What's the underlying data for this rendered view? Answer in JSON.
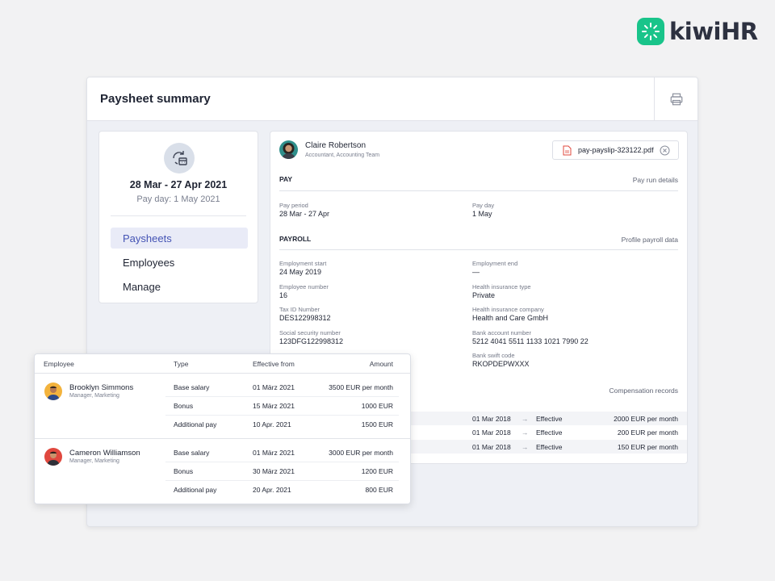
{
  "brand": {
    "name": "kiwiHR",
    "color": "#19c48a"
  },
  "window": {
    "title": "Paysheet summary",
    "print_icon": "printer-icon"
  },
  "period": {
    "icon": "calendar-cycle-icon",
    "range": "28 Mar - 27 Apr 2021",
    "payday": "Pay day: 1 May 2021"
  },
  "nav": {
    "items": [
      {
        "label": "Paysheets",
        "active": true
      },
      {
        "label": "Employees",
        "active": false
      },
      {
        "label": "Manage",
        "active": false
      }
    ],
    "active_color": "#4453b4"
  },
  "employee": {
    "name": "Claire Robertson",
    "role": "Accountant, Accounting Team",
    "file": "pay-payslip-323122.pdf",
    "file_icon": "pdf-icon",
    "close_icon": "close-circle-icon"
  },
  "pay": {
    "title": "PAY",
    "link": "Pay run details",
    "fields": [
      {
        "label": "Pay period",
        "value": "28 Mar - 27 Apr"
      },
      {
        "label": "Pay day",
        "value": "1 May"
      }
    ]
  },
  "payroll": {
    "title": "PAYROLL",
    "link": "Profile payroll data",
    "fields": [
      {
        "label": "Employment start",
        "value": "24 May 2019"
      },
      {
        "label": "Employment end",
        "value": "—"
      },
      {
        "label": "Employee number",
        "value": "16"
      },
      {
        "label": "Health insurance type",
        "value": "Private"
      },
      {
        "label": "Tax ID Number",
        "value": "DES122998312"
      },
      {
        "label": "Health insurance company",
        "value": "Health and Care GmbH"
      },
      {
        "label": "Social security number",
        "value": "123DFG122998312"
      },
      {
        "label": "Bank account number",
        "value": "5212 4041 5511 1133 1021 7990 22"
      },
      {
        "label": "Bank swift code",
        "value": "RKOPDEPWXXX"
      }
    ]
  },
  "compensation": {
    "link": "Compensation records",
    "rows": [
      {
        "date": "01 Mar 2018",
        "status": "Effective",
        "amount": "2000 EUR per month"
      },
      {
        "date": "01 Mar 2018",
        "status": "Effective",
        "amount": "200 EUR per month"
      },
      {
        "date": "01 Mar 2018",
        "status": "Effective",
        "amount": "150 EUR per month"
      }
    ]
  },
  "table": {
    "headers": {
      "employee": "Employee",
      "type": "Type",
      "effective": "Effective from",
      "amount": "Amount"
    },
    "groups": [
      {
        "name": "Brooklyn Simmons",
        "role": "Manager, Marketing",
        "avatar_color": "#f3b33d",
        "rows": [
          {
            "type": "Base salary",
            "effective": "01 März 2021",
            "amount": "3500 EUR per month"
          },
          {
            "type": "Bonus",
            "effective": "15 März 2021",
            "amount": "1000 EUR"
          },
          {
            "type": "Additional pay",
            "effective": "10 Apr. 2021",
            "amount": "1500 EUR"
          }
        ]
      },
      {
        "name": "Cameron Williamson",
        "role": "Manager, Marketing",
        "avatar_color": "#e0483e",
        "rows": [
          {
            "type": "Base salary",
            "effective": "01 März 2021",
            "amount": "3000 EUR per month"
          },
          {
            "type": "Bonus",
            "effective": "30 März 2021",
            "amount": "1200 EUR"
          },
          {
            "type": "Additional pay",
            "effective": "20 Apr. 2021",
            "amount": "800 EUR"
          }
        ]
      }
    ]
  }
}
